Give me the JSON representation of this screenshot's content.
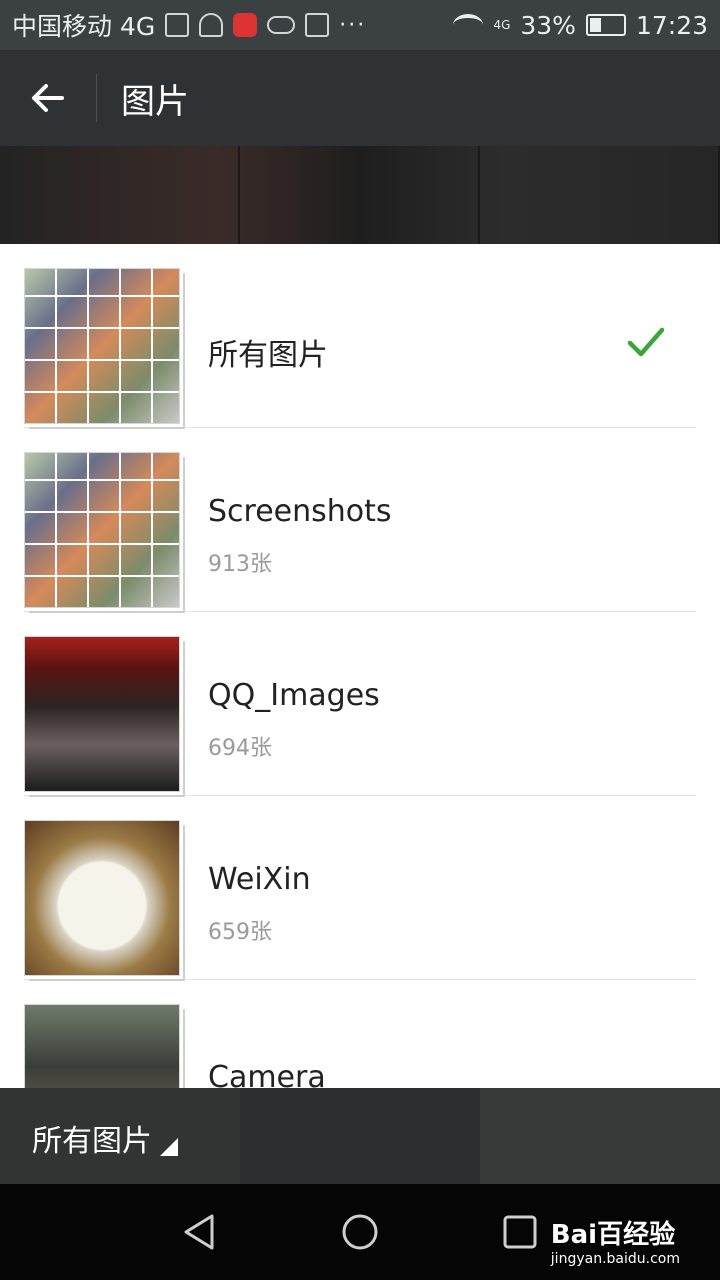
{
  "status_bar": {
    "carrier": "中国移动 4G",
    "network": "4G",
    "battery": "33%",
    "battery_fraction": 0.33,
    "time": "17:23",
    "icons": [
      "image-icon",
      "lock-icon",
      "app-badge-icon",
      "cloud-icon",
      "mail-icon",
      "more-icon",
      "wifi-icon",
      "signal-icon",
      "battery-icon"
    ]
  },
  "header": {
    "back_icon": "arrow-left-icon",
    "title": "图片"
  },
  "albums": [
    {
      "name": "所有图片",
      "count": "",
      "selected": true,
      "thumb": "grid"
    },
    {
      "name": "Screenshots",
      "count": "913张",
      "selected": false,
      "thumb": "grid"
    },
    {
      "name": "QQ_Images",
      "count": "694张",
      "selected": false,
      "thumb": "poster"
    },
    {
      "name": "WeiXin",
      "count": "659张",
      "selected": false,
      "thumb": "food"
    },
    {
      "name": "Camera",
      "count": "",
      "selected": false,
      "thumb": "camera"
    }
  ],
  "bottom_bar": {
    "folder_label": "所有图片"
  },
  "nav": {
    "icons": [
      "back-triangle-icon",
      "home-circle-icon",
      "recents-square-icon"
    ]
  },
  "watermark": {
    "brand": "Bai百经验",
    "url": "jingyan.baidu.com"
  },
  "colors": {
    "check": "#3aa53a",
    "titlebar": "#2f3235"
  }
}
